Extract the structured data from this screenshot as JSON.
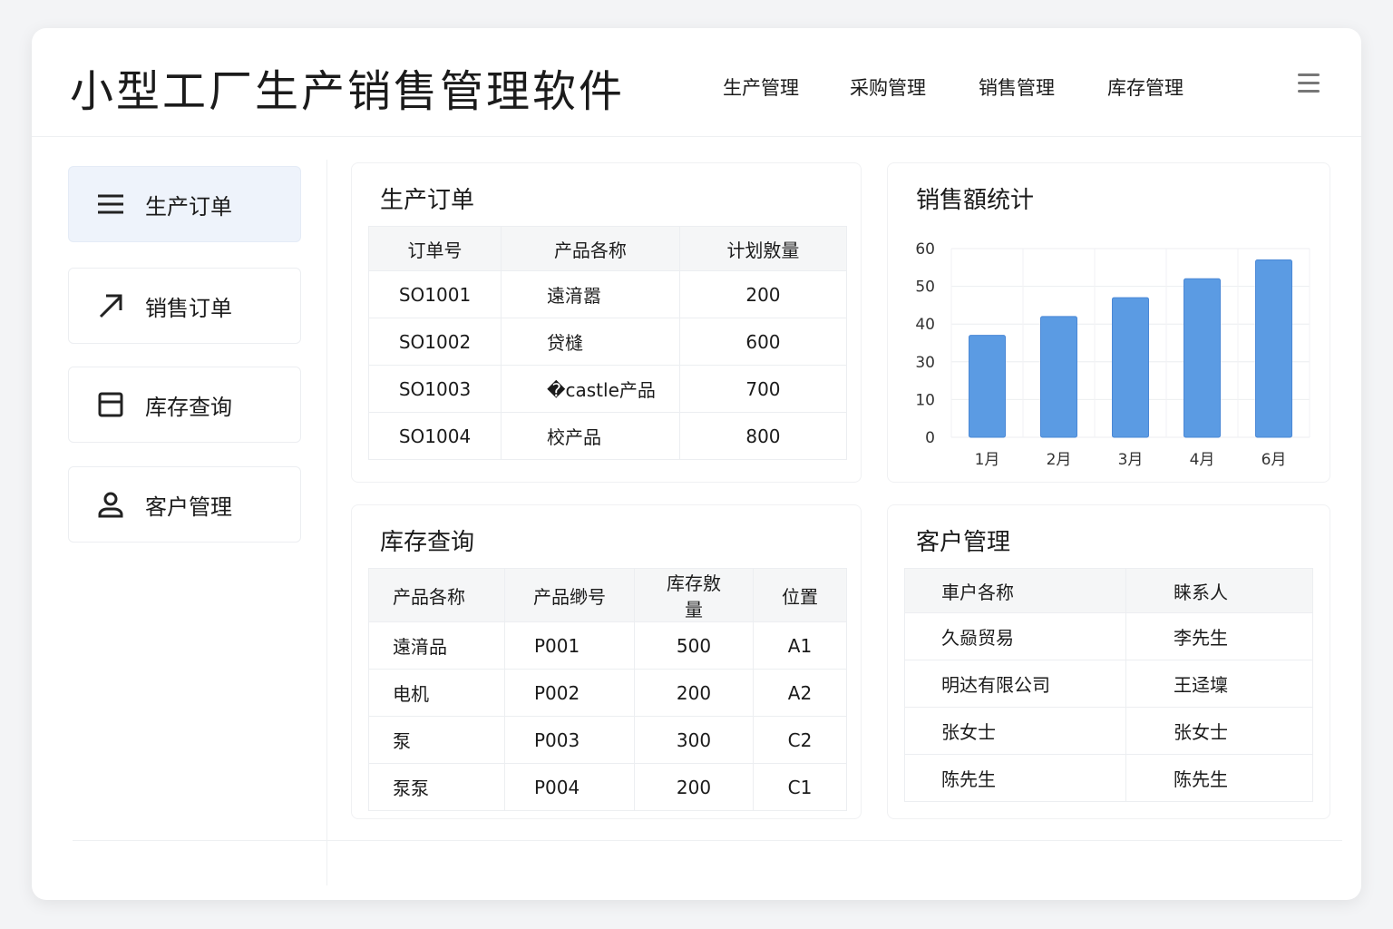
{
  "header": {
    "title": "小型工厂生产销售管理软件",
    "nav": [
      "生产管理",
      "采购管理",
      "销售管理",
      "库存管理"
    ],
    "menu_icon": "hamburger-icon"
  },
  "sidebar": {
    "items": [
      {
        "label": "生产订单",
        "icon": "list-icon"
      },
      {
        "label": "销售订单",
        "icon": "arrow-up-right-icon"
      },
      {
        "label": "库存查询",
        "icon": "box-icon"
      },
      {
        "label": "客户管理",
        "icon": "user-icon"
      }
    ]
  },
  "production": {
    "title": "生产订单",
    "headers": [
      "订单号",
      "产品各称",
      "计划敫量"
    ],
    "rows": [
      [
        "SO1001",
        "遠湇嚣",
        "200"
      ],
      [
        "SO1002",
        "贷槰",
        "600"
      ],
      [
        "SO1003",
        "�castle产品",
        "700"
      ],
      [
        "SO1004",
        "校产品",
        "800"
      ]
    ]
  },
  "inventory": {
    "title": "库存查询",
    "headers": [
      "产品各称",
      "产品缈号",
      "库存敫量",
      "位置"
    ],
    "rows": [
      [
        "遠湇品",
        "P001",
        "500",
        "A1"
      ],
      [
        "电机",
        "P002",
        "200",
        "A2"
      ],
      [
        "泵",
        "P003",
        "300",
        "C2"
      ],
      [
        "泵泵",
        "P004",
        "200",
        "C1"
      ]
    ]
  },
  "customers": {
    "title": "客户管理",
    "headers": [
      "車户各称",
      "睐系人"
    ],
    "rows": [
      [
        "久赑贸易",
        "李先生"
      ],
      [
        "明达有限公司",
        "王迳壈"
      ],
      [
        "张女士",
        "张女士"
      ],
      [
        "陈先生",
        "陈先生"
      ]
    ]
  },
  "colors": {
    "bar": "#5b9be3",
    "active": "#eef3fb"
  },
  "chart_data": {
    "type": "bar",
    "title": "销售額统计",
    "categories": [
      "1月",
      "2月",
      "3月",
      "4月",
      "6月"
    ],
    "values": [
      37,
      42,
      47,
      52,
      57
    ],
    "yticks": [
      0,
      10,
      30,
      40,
      50,
      60
    ],
    "ylim": [
      0,
      60
    ],
    "grid": true,
    "xlabel": "",
    "ylabel": ""
  }
}
